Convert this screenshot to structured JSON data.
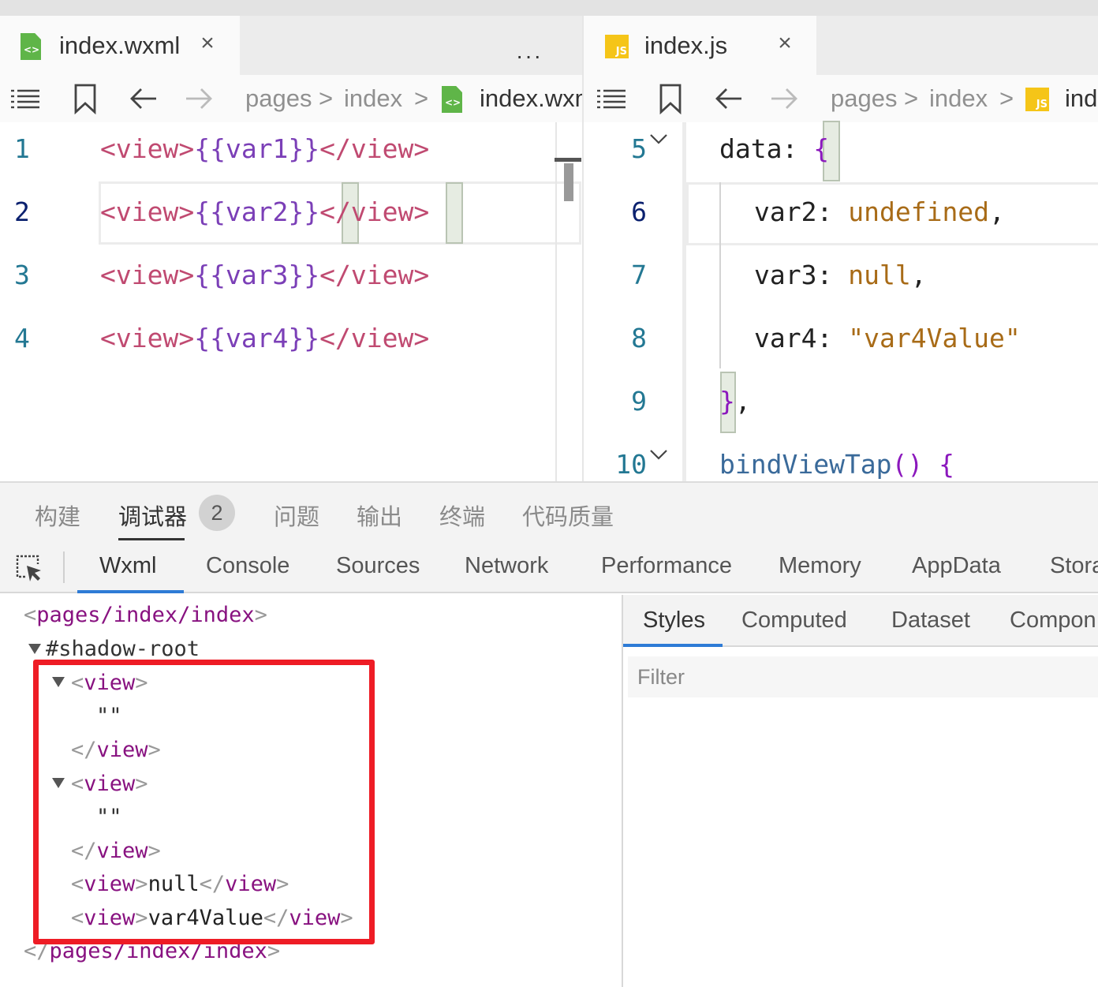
{
  "left_editor": {
    "tab": {
      "file_name": "index.wxml",
      "close_glyph": "×",
      "icon": "wxml-file-icon"
    },
    "more_glyph": "···",
    "breadcrumb": {
      "segments": [
        "pages",
        "index"
      ],
      "file": "index.wxml",
      "separator": ">"
    },
    "lines": [
      {
        "no": "1",
        "open": "<view>",
        "var": "{{var1}}",
        "close": "</view>"
      },
      {
        "no": "2",
        "open": "<view>",
        "var": "{{var2}}",
        "close": "</view>"
      },
      {
        "no": "3",
        "open": "<view>",
        "var": "{{var3}}",
        "close": "</view>"
      },
      {
        "no": "4",
        "open": "<view>",
        "var": "{{var4}}",
        "close": "</view>"
      }
    ]
  },
  "right_editor": {
    "tab": {
      "file_name": "index.js",
      "close_glyph": "×",
      "icon": "js-file-icon",
      "icon_text": "JS"
    },
    "breadcrumb": {
      "segments": [
        "pages",
        "index"
      ],
      "file": "ind",
      "separator": ">"
    },
    "lines": [
      {
        "no": "5",
        "parts": [
          "data",
          ": ",
          "{"
        ]
      },
      {
        "no": "6",
        "parts": [
          "var2",
          ": ",
          "undefined",
          ","
        ]
      },
      {
        "no": "7",
        "parts": [
          "var3",
          ": ",
          "null",
          ","
        ]
      },
      {
        "no": "8",
        "parts": [
          "var4",
          ": ",
          "\"var4Value\""
        ]
      },
      {
        "no": "9",
        "parts": [
          "}",
          ","
        ]
      },
      {
        "no": "10",
        "parts": [
          "bindViewTap",
          "()",
          " {"
        ]
      }
    ]
  },
  "panel_tabs": [
    "构建",
    "调试器",
    "问题",
    "输出",
    "终端",
    "代码质量"
  ],
  "panel_badge": "2",
  "devtools_tabs": [
    "Wxml",
    "Console",
    "Sources",
    "Network",
    "Performance",
    "Memory",
    "AppData",
    "Stora"
  ],
  "wxml_tree": {
    "root_open": [
      "<",
      "pages/index/index",
      ">"
    ],
    "shadow_root": "#shadow-root",
    "view_tag": "view",
    "empty_text": "\"\"",
    "null_text": "null",
    "var4_text": "var4Value",
    "root_close": [
      "</",
      "pages/index/index",
      ">"
    ]
  },
  "styles_pane": {
    "tabs": [
      "Styles",
      "Computed",
      "Dataset",
      "Compon"
    ],
    "filter_placeholder": "Filter"
  },
  "colors": {
    "highlight_box": "#ee1c25",
    "active_underline": "#2e7bd6",
    "wxml_icon": "#5fb548",
    "js_icon": "#f5c518"
  }
}
